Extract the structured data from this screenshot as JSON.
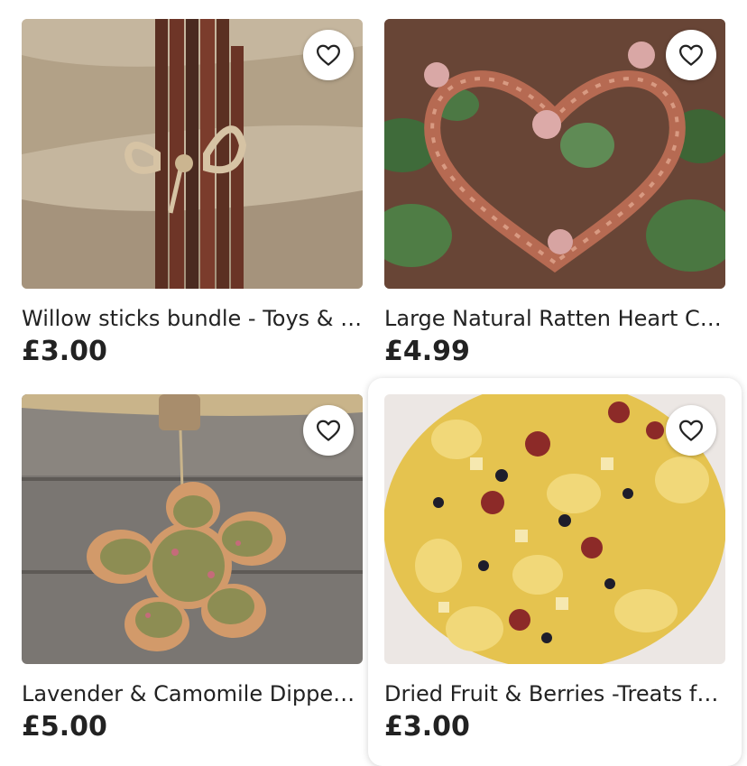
{
  "listings": [
    {
      "title": "Willow sticks bundle - Toys & Chews for rabbits",
      "price": "£3.00",
      "favorite_icon": "heart-outline-icon"
    },
    {
      "title": "Large Natural Ratten Heart Chew",
      "price": "£4.99",
      "favorite_icon": "heart-outline-icon"
    },
    {
      "title": "Lavender & Camomile Dipped Flower",
      "price": "£5.00",
      "favorite_icon": "heart-outline-icon"
    },
    {
      "title": "Dried Fruit & Berries -Treats for small pets",
      "price": "£3.00",
      "favorite_icon": "heart-outline-icon"
    }
  ],
  "colors": {
    "text": "#222222",
    "background": "#ffffff",
    "heart_stroke": "#222222"
  }
}
